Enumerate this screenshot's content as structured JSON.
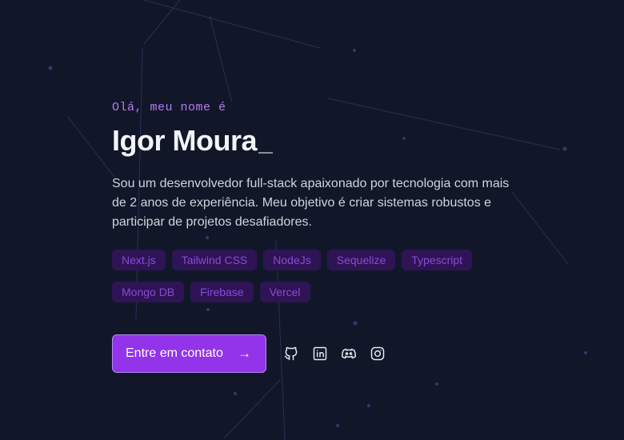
{
  "hero": {
    "greeting": "Olá, meu nome é",
    "name": "Igor Moura",
    "intro": "Sou um desenvolvedor full-stack apaixonado por tecnologia com mais de 2 anos de experiência. Meu objetivo é criar sistemas robustos e participar de projetos desafiadores.",
    "tags": [
      "Next.js",
      "Tailwind CSS",
      "NodeJs",
      "Sequelize",
      "Typescript",
      "Mongo DB",
      "Firebase",
      "Vercel"
    ],
    "cta_label": "Entre em contato",
    "cta_arrow": "→"
  },
  "socials": [
    {
      "icon": "github-icon"
    },
    {
      "icon": "linkedin-icon"
    },
    {
      "icon": "discord-icon"
    },
    {
      "icon": "instagram-icon"
    }
  ],
  "colors": {
    "background": "#111728",
    "accent": "#9333ea",
    "tag_background": "#2e1454",
    "tag_text": "#8b49d9",
    "greeting": "#b57bf2"
  }
}
